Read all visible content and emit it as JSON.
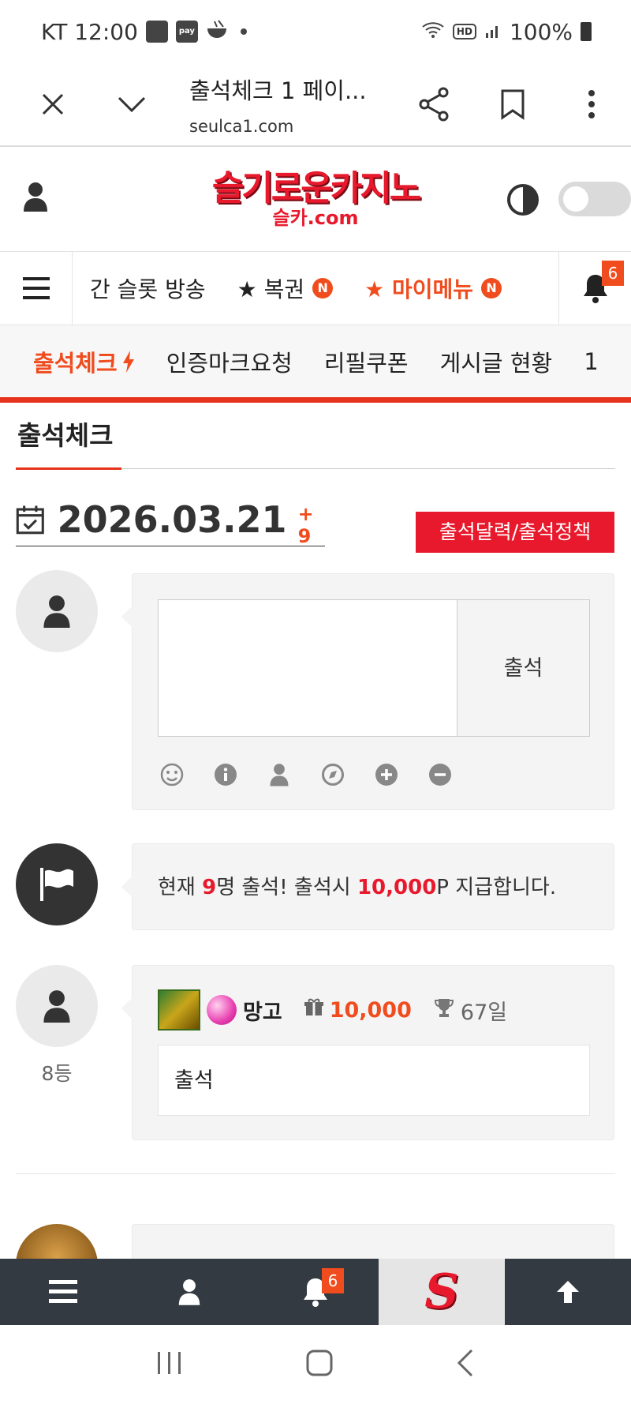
{
  "status_bar": {
    "time_carrier": "KT 12:00",
    "pay_label": "pay",
    "battery": "100%"
  },
  "browser": {
    "title": "출석체크 1 페이...",
    "url": "seulca1.com"
  },
  "site": {
    "logo_main": "슬기로운카지노",
    "logo_sub": "슬카.com"
  },
  "nav_primary": {
    "items": [
      {
        "label": "간 슬롯 방송"
      },
      {
        "label": "★ 복권",
        "badge": "N"
      },
      {
        "label": "★ 마이메뉴",
        "badge": "N"
      }
    ],
    "notification_count": "6"
  },
  "nav_secondary": {
    "items": [
      "출석체크",
      "인증마크요청",
      "리필쿠폰",
      "게시글 현황",
      "1"
    ]
  },
  "page": {
    "title": "출석체크",
    "date": "2026.03.21",
    "date_delta": "+ 9",
    "calendar_button": "출석달력/출석정책"
  },
  "composer": {
    "submit_label": "출석",
    "textarea_value": ""
  },
  "notice": {
    "prefix": "현재 ",
    "count": "9",
    "middle": "명 출석! 출석시 ",
    "points": "10,000",
    "suffix": "P 지급합니다."
  },
  "entries": [
    {
      "nickname": "망고",
      "points": "10,000",
      "days": "67일",
      "message": "출석",
      "rank": "8등"
    }
  ],
  "bottom_nav": {
    "notification_count": "6",
    "logo_letter": "S"
  },
  "colors": {
    "accent": "#e6331c",
    "brand_red": "#e8192c",
    "orange": "#f04c1e",
    "bottom_bar": "#333a42"
  }
}
